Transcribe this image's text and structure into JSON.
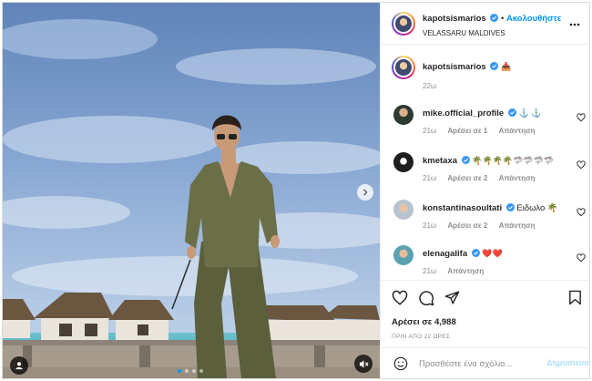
{
  "post": {
    "username": "kapotsismarios",
    "follow_label": "Ακολουθήστε",
    "follow_separator": "•",
    "location": "VELASSARU MALDIVES",
    "more_icon": "more-horizontal-icon"
  },
  "caption": {
    "username": "kapotsismarios",
    "text": "📥",
    "time": "22ω"
  },
  "comments": [
    {
      "username": "mike.official_profile",
      "text": "⚓ ⚓",
      "time": "21ω",
      "likes": "Αρέσει σε 1",
      "reply": "Απάντηση"
    },
    {
      "username": "kmetaxa",
      "text": "🌴🌴🌴🌴🦈🦈🦈🦈",
      "time": "21ω",
      "likes": "Αρέσει σε 2",
      "reply": "Απάντηση"
    },
    {
      "username": "konstantinasoultati",
      "text": "Ειδωλο 🌴",
      "time": "21ω",
      "likes": "Αρέσει σε 2",
      "reply": "Απάντηση"
    },
    {
      "username": "elenagalifa",
      "text": "❤️❤️",
      "time": "21ω",
      "likes": "",
      "reply": "Απάντηση"
    }
  ],
  "actions": {
    "likes": "Αρέσει σε 4,988",
    "timestamp": "ΠΡΙΝ ΑΠΟ 22 ΩΡΕΣ"
  },
  "add_comment": {
    "placeholder": "Προσθέστε ένα σχόλιο...",
    "post_label": "Δημοσίευση"
  },
  "carousel": {
    "total": 4,
    "current": 1
  },
  "colors": {
    "accent": "#0095f6",
    "verified": "#3897f0",
    "muted": "#8e8e8e"
  }
}
